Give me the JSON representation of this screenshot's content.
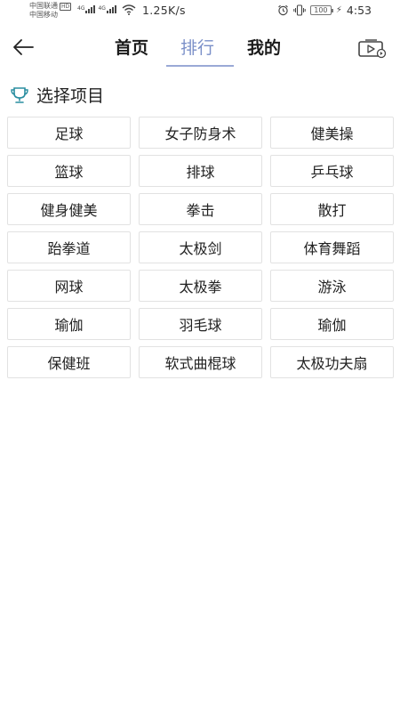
{
  "status_bar": {
    "carrier1": "中国联通",
    "carrier1_badge": "HD",
    "carrier2": "中国移动",
    "signal_tag1": "4G",
    "signal_tag2": "4G",
    "net_speed": "1.25K/s",
    "battery": "100",
    "time": "4:53"
  },
  "header": {
    "back_icon": "arrow-left-icon",
    "tabs": [
      {
        "label": "首页",
        "active": false
      },
      {
        "label": "排行",
        "active": true
      },
      {
        "label": "我的",
        "active": false
      }
    ],
    "right_icon": "video-play-icon",
    "active_color": "#7a8fc8"
  },
  "section": {
    "icon": "trophy-icon",
    "title": "选择项目",
    "icon_color": "#2a8ea0"
  },
  "sports": [
    "足球",
    "女子防身术",
    "健美操",
    "篮球",
    "排球",
    "乒乓球",
    "健身健美",
    "拳击",
    "散打",
    "跆拳道",
    "太极剑",
    "体育舞蹈",
    "网球",
    "太极拳",
    "游泳",
    "瑜伽",
    "羽毛球",
    "瑜伽",
    "保健班",
    "软式曲棍球",
    "太极功夫扇"
  ]
}
